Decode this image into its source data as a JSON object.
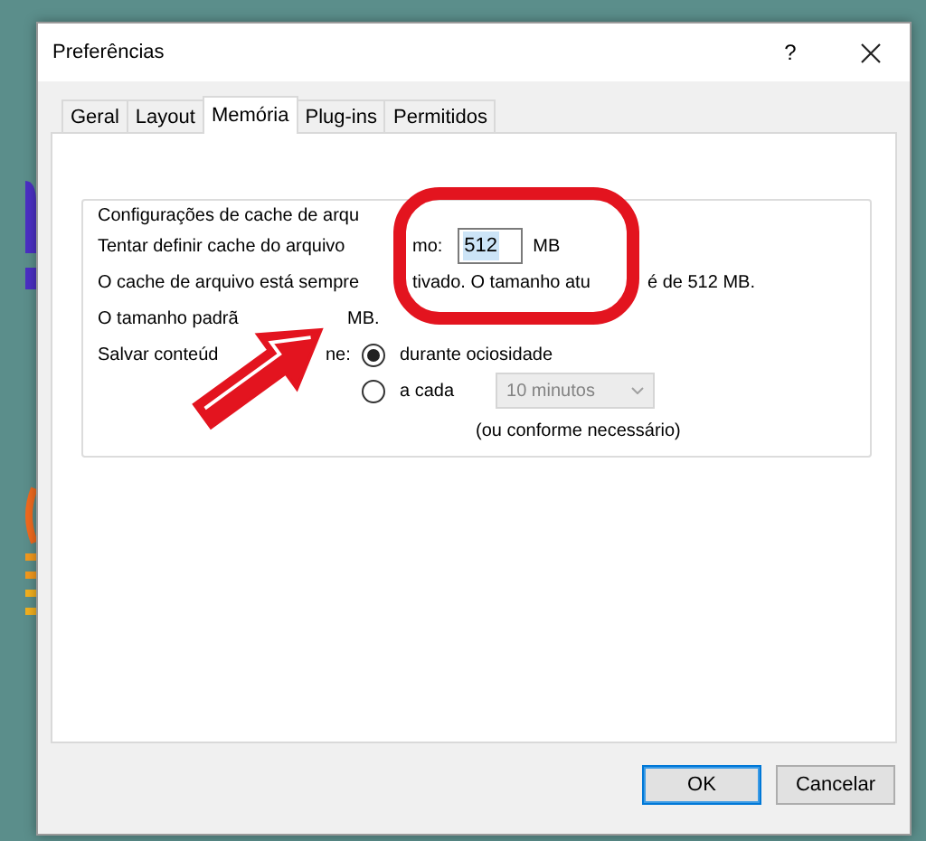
{
  "window": {
    "title": "Preferências",
    "help": "?"
  },
  "tabs": [
    {
      "label": "Geral",
      "selected": false
    },
    {
      "label": "Layout",
      "selected": false
    },
    {
      "label": "Memória",
      "selected": true
    },
    {
      "label": "Plug-ins",
      "selected": false
    },
    {
      "label": "Permitidos",
      "selected": false
    }
  ],
  "group": {
    "legend": "Configurações de cache de arqu"
  },
  "cache_size": {
    "label_parts": [
      "Tentar definir cache do arquivo",
      "mo:"
    ],
    "value": "512",
    "highlighted": true,
    "unit": "MB"
  },
  "info_lines": [
    {
      "parts": [
        "O cache de arquivo está sempre",
        "tivado. O tamanho atu",
        "é de 512 MB."
      ]
    },
    {
      "parts": [
        "O tamanho padrã",
        "MB."
      ]
    }
  ],
  "save": {
    "label_parts": [
      "Salvar conteúd",
      "ne:"
    ],
    "options": [
      {
        "label": "durante ociosidade",
        "selected": true
      },
      {
        "label": "a cada",
        "selected": false
      }
    ],
    "interval": {
      "value": "10 minutos",
      "disabled": true
    },
    "note": "(ou conforme necessário)"
  },
  "buttons": [
    {
      "label": "OK",
      "default": true
    },
    {
      "label": "Cancelar",
      "default": false
    }
  ]
}
